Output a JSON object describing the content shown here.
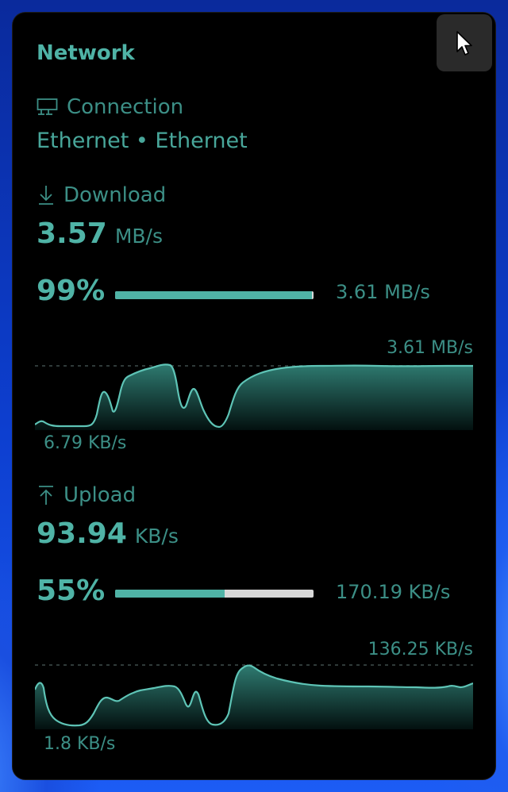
{
  "widget": {
    "title": "Network"
  },
  "connection": {
    "label": "Connection",
    "value": "Ethernet • Ethernet",
    "icon": "ethernet-icon"
  },
  "download": {
    "label": "Download",
    "icon": "download-arrow-icon",
    "speed_value": "3.57",
    "speed_unit": "MB/s",
    "percent_label": "99%",
    "percent": 99,
    "max_label": "3.61 MB/s",
    "graph_max_label": "3.61 MB/s",
    "graph_min_label": "6.79 KB/s"
  },
  "upload": {
    "label": "Upload",
    "icon": "upload-arrow-icon",
    "speed_value": "93.94",
    "speed_unit": "KB/s",
    "percent_label": "55%",
    "percent": 55,
    "max_label": "170.19 KB/s",
    "graph_max_label": "136.25 KB/s",
    "graph_min_label": "1.8 KB/s"
  },
  "colors": {
    "accent": "#4fb3a6",
    "panel_bg": "#000000",
    "bar_track": "#d8d8d8"
  }
}
